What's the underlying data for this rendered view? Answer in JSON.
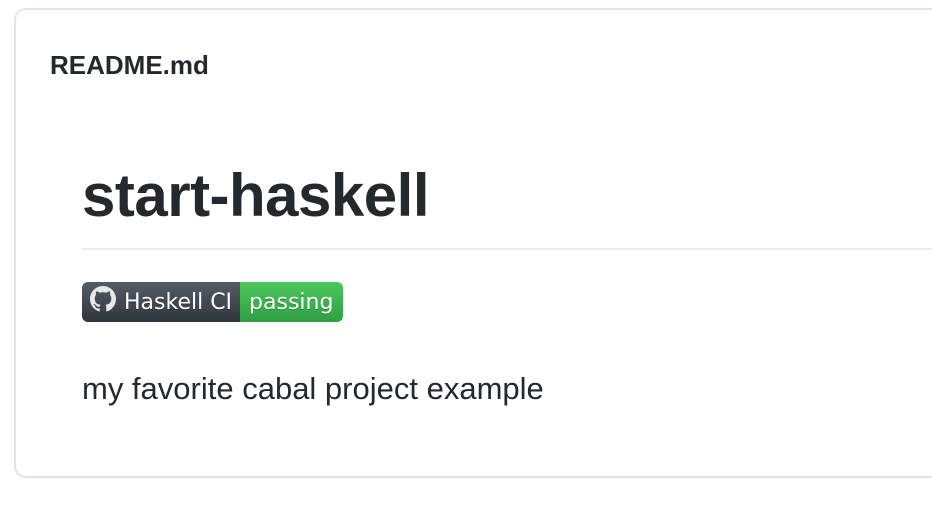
{
  "readme": {
    "filename": "README.md",
    "title": "start-haskell",
    "description": "my favorite cabal project example"
  },
  "badge": {
    "icon": "github-icon",
    "label": "Haskell CI",
    "status": "passing",
    "label_color": "#3a4048",
    "status_color": "#34b24a"
  },
  "colors": {
    "text": "#24292e",
    "border": "#e1e4e8",
    "divider": "#eaecef"
  }
}
